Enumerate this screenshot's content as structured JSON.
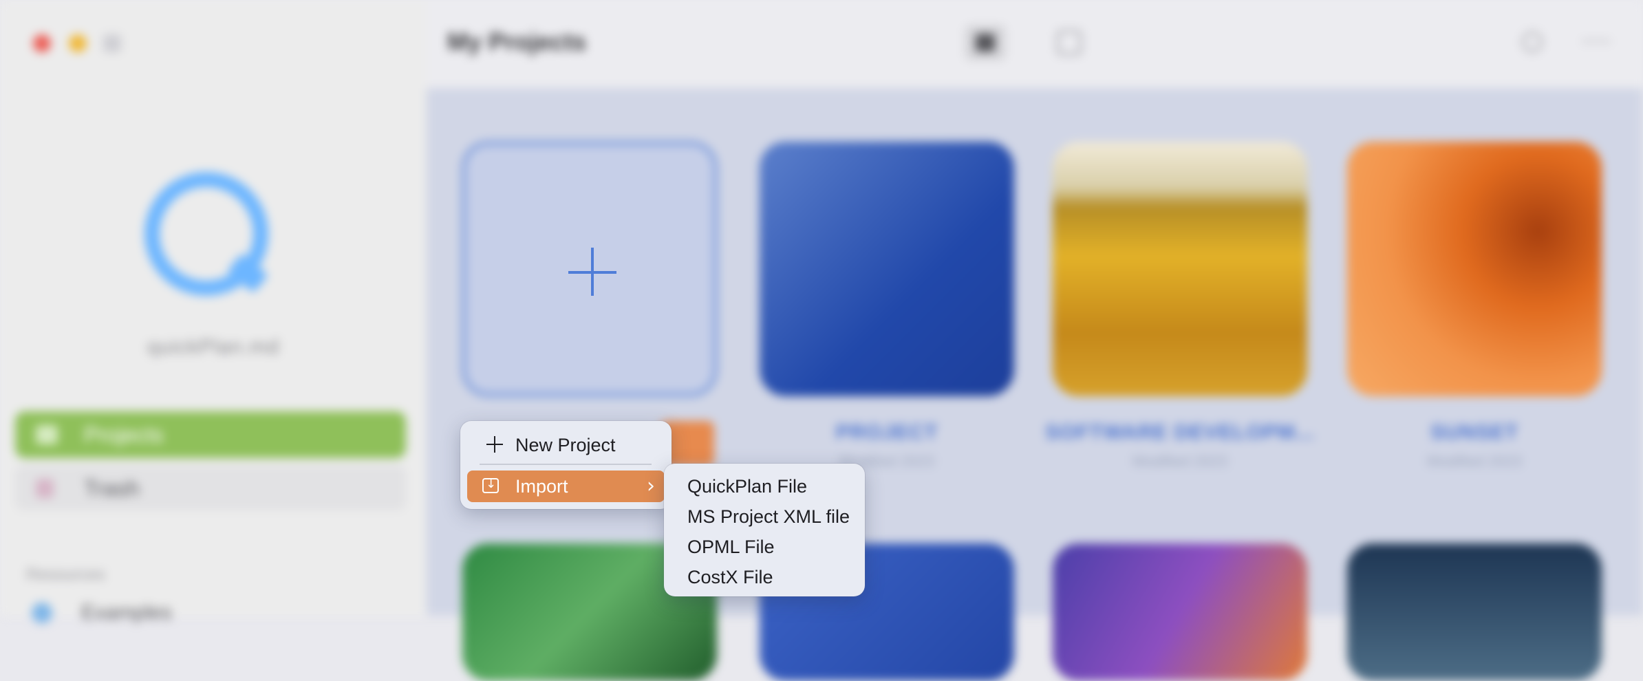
{
  "window": {
    "traffic_lights": [
      "close",
      "minimize",
      "sidebar-toggle"
    ]
  },
  "sidebar": {
    "account_name": "quickPlan.md",
    "nav": [
      {
        "label": "Projects",
        "icon": "folder-icon",
        "selected": true
      },
      {
        "label": "Trash",
        "icon": "trash-icon",
        "selected": false
      }
    ],
    "resources_header": "Resources",
    "resources": [
      {
        "label": "Examples",
        "icon": "globe-icon"
      }
    ],
    "colors": {
      "selected": "#8fc05a",
      "logo": "#6db6ff"
    }
  },
  "toolbar": {
    "title": "My Projects",
    "view_modes": [
      "grid",
      "list"
    ],
    "active_view": "grid",
    "actions": [
      "search-icon",
      "more-icon"
    ]
  },
  "projects": [
    {
      "label": "PROJECT",
      "sub": "Modified 2023"
    },
    {
      "label": "SOFTWARE DEVELOPM...",
      "sub": "Modified 2023"
    },
    {
      "label": "SUNSET",
      "sub": "Modified 2023"
    }
  ],
  "context_menu": {
    "items": [
      {
        "label": "New Project",
        "icon": "plus-icon"
      },
      {
        "label": "Import",
        "icon": "import-icon",
        "highlighted": true,
        "has_submenu": true
      }
    ],
    "highlight_color": "#e08b51",
    "submenu": [
      {
        "label": "QuickPlan File"
      },
      {
        "label": "MS Project XML file"
      },
      {
        "label": "OPML File"
      },
      {
        "label": "CostX File"
      }
    ]
  }
}
